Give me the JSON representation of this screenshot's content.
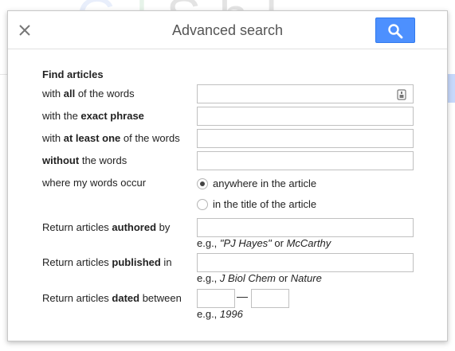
{
  "background": {
    "logo_letters": [
      "G",
      "S",
      "h",
      "l"
    ]
  },
  "dialog": {
    "title": "Advanced search",
    "close_icon": "close-icon",
    "search_icon": "search-icon"
  },
  "form": {
    "section_title": "Find articles",
    "all_words": {
      "prefix": "with ",
      "bold": "all",
      "suffix": " of the words",
      "value": ""
    },
    "exact_phrase": {
      "prefix": "with the ",
      "bold": "exact phrase",
      "suffix": "",
      "value": ""
    },
    "at_least_one": {
      "prefix": "with ",
      "bold": "at least one",
      "suffix": " of the words",
      "value": ""
    },
    "without": {
      "prefix": "",
      "bold": "without",
      "suffix": " the words",
      "value": ""
    },
    "occur": {
      "label": "where my words occur",
      "options": [
        "anywhere in the article",
        "in the title of the article"
      ],
      "selected": "anywhere in the article"
    },
    "authored": {
      "prefix": "Return articles ",
      "bold": "authored",
      "suffix": " by",
      "value": "",
      "hint_prefix": "e.g., ",
      "hint_em1": "\"PJ Hayes\"",
      "hint_mid": " or ",
      "hint_em2": "McCarthy"
    },
    "published": {
      "prefix": "Return articles ",
      "bold": "published",
      "suffix": " in",
      "value": "",
      "hint_prefix": "e.g., ",
      "hint_em1": "J Biol Chem",
      "hint_mid": " or ",
      "hint_em2": "Nature"
    },
    "dated": {
      "prefix": "Return articles ",
      "bold": "dated",
      "suffix": " between",
      "from_value": "",
      "to_value": "",
      "separator": "—",
      "hint_prefix": "e.g., ",
      "hint_em": "1996"
    }
  }
}
